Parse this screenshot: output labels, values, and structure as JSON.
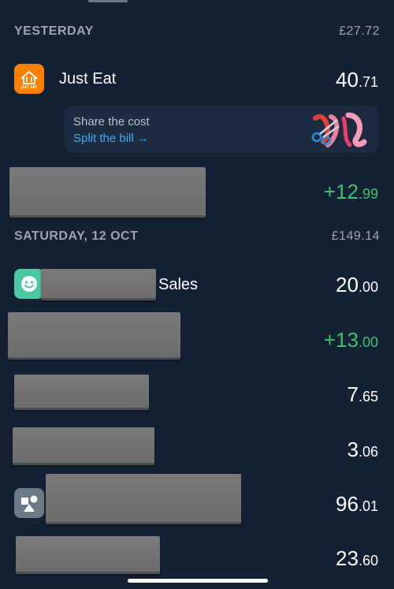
{
  "sections": [
    {
      "title": "YESTERDAY",
      "total": "£27.72"
    },
    {
      "title": "SATURDAY, 12 OCT",
      "total": "£149.14"
    }
  ],
  "transactions": {
    "just_eat": {
      "name": "Just Eat",
      "icon": "just-eat-icon",
      "icon_text": "JUST EAT",
      "pounds": "40",
      "pence": ".71",
      "icon_color": "#ff8000"
    },
    "refund_1": {
      "pounds": "+12",
      "pence": ".99",
      "color": "#36c76a"
    },
    "sales": {
      "name": "Sales",
      "icon": "smiley-icon",
      "pounds": "20",
      "pence": ".00",
      "icon_color": "#4bc7a3"
    },
    "refund_2": {
      "pounds": "+13",
      "pence": ".00",
      "color": "#36c76a"
    },
    "t_765": {
      "pounds": "7",
      "pence": ".65"
    },
    "t_306": {
      "pounds": "3",
      "pence": ".06"
    },
    "t_9601": {
      "icon": "shapes-icon",
      "pounds": "96",
      "pence": ".01",
      "icon_color": "#6c7a86"
    },
    "t_2360": {
      "pounds": "23",
      "pence": ".60"
    }
  },
  "promo": {
    "title": "Share the cost",
    "link": "Split the bill →",
    "art_icon": "scissors-ribbon-icon"
  },
  "colors": {
    "background": "#142033",
    "promo_bg": "#1d2b40",
    "link": "#3fa9f5",
    "positive": "#36c76a",
    "muted": "#9aa4b3"
  }
}
